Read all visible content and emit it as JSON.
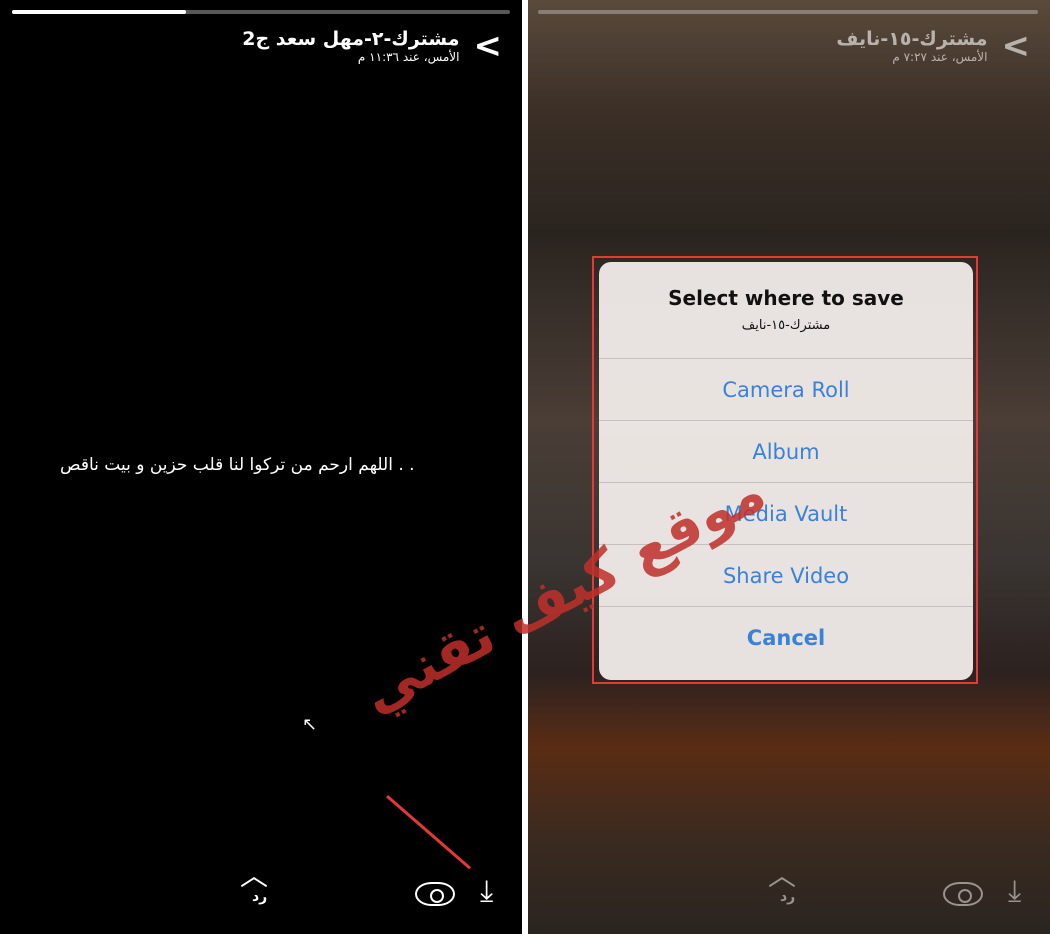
{
  "left": {
    "title": "مشترك-٢-مهل سعد ج2",
    "subtitle": "الأمس، عند ١١:٣٦ م",
    "caption": ". . اللهم ارحم من تركوا لنا قلب حزين و بيت ناقص",
    "reply": "رد",
    "progress": 0.35
  },
  "right": {
    "title": "مشترك-١٥-نايف",
    "subtitle": "الأمس، عند ٧:٢٧ م",
    "reply": "رد",
    "dialog": {
      "title": "Select where to save",
      "subtitle": "مشترك-١٥-نايف",
      "options": [
        "Camera Roll",
        "Album",
        "Media Vault",
        "Share Video"
      ],
      "cancel": "Cancel"
    }
  },
  "watermark": "موقع كيف تقني",
  "colors": {
    "annotation": "#e53935",
    "link": "#3a82d8"
  }
}
